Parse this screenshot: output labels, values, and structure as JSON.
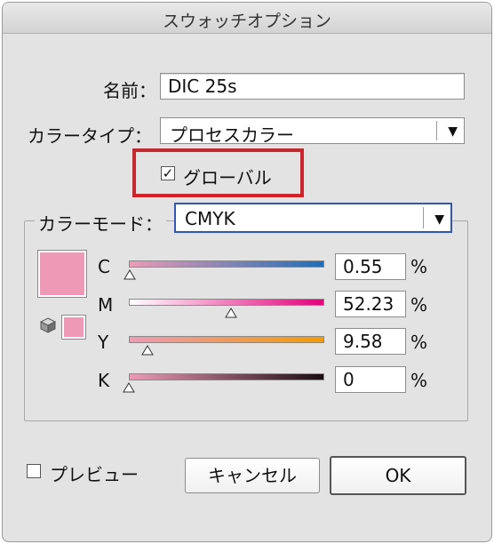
{
  "window": {
    "title": "スウォッチオプション"
  },
  "name_field": {
    "label": "名前：",
    "value": "DIC 25s"
  },
  "color_type": {
    "label": "カラータイプ：",
    "value": "プロセスカラー"
  },
  "global": {
    "label": "グローバル",
    "checked": true
  },
  "color_mode": {
    "label": "カラーモード：",
    "value": "CMYK"
  },
  "swatch": {
    "color": "#ee9ab6"
  },
  "channels": [
    {
      "label": "C",
      "value": "0.55",
      "unit": "%",
      "level": 0.0055
    },
    {
      "label": "M",
      "value": "52.23",
      "unit": "%",
      "level": 0.5223
    },
    {
      "label": "Y",
      "value": "9.58",
      "unit": "%",
      "level": 0.0958
    },
    {
      "label": "K",
      "value": "0",
      "unit": "%",
      "level": 0
    }
  ],
  "preview": {
    "label": "プレビュー",
    "checked": false
  },
  "buttons": {
    "cancel": "キャンセル",
    "ok": "OK"
  },
  "colors": {
    "highlight_red": "#d2232a",
    "highlight_blue": "#2e58b5"
  }
}
